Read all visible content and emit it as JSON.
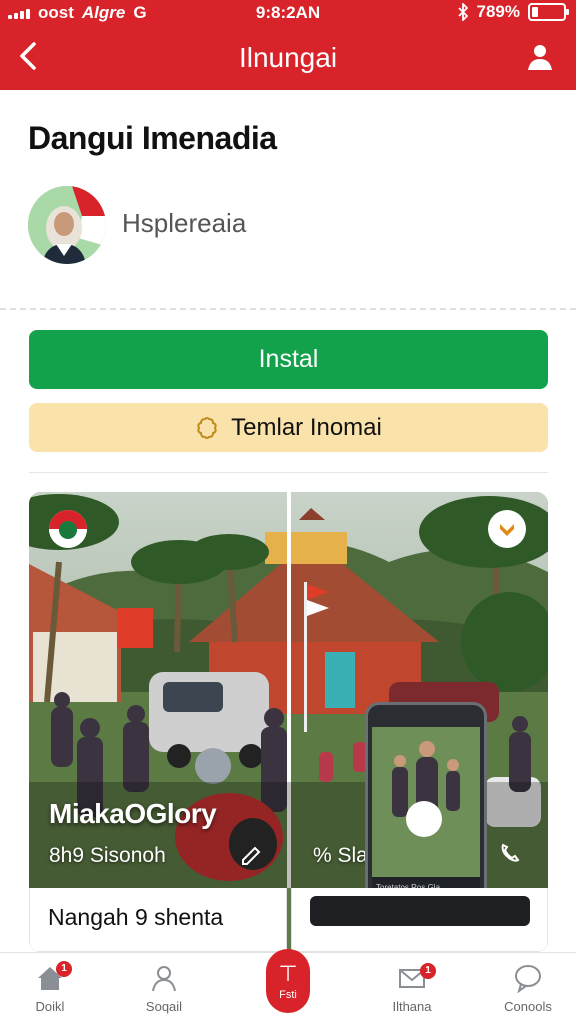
{
  "status_bar": {
    "carrier": "oost",
    "network": "Algre",
    "network_glyph": "G",
    "time": "9:8:2AN",
    "battery_percent": "789%",
    "battery_level": 0.2
  },
  "header": {
    "title": "Ilnungai",
    "back_icon": "back-arrow-icon",
    "user_icon": "user-profile-icon",
    "color": "#d8232a"
  },
  "app": {
    "name": "Dangui Imenadia",
    "publisher": "Hsplereaia"
  },
  "actions": {
    "install_label": "Instal",
    "secondary_label": "Temlar Inomai",
    "install_color": "#14a14b",
    "secondary_color": "#f9e3aa"
  },
  "media": {
    "left_caption_title": "MiakaOGlory",
    "left_caption_sub": "8h9 Sisonoh",
    "right_caption_sub": "% Slau",
    "phone_text": "Toretatos Ros Gla"
  },
  "items": [
    {
      "label": "Nangah  9  shenta"
    },
    {
      "label": ""
    }
  ],
  "bottom_nav": {
    "tabs": [
      {
        "label": "Doikl",
        "icon": "home-icon",
        "badge": "1"
      },
      {
        "label": "Soqail",
        "icon": "person-icon",
        "badge": ""
      },
      {
        "label": "Fsti",
        "icon": "center-action-icon",
        "badge": ""
      },
      {
        "label": "Ilthana",
        "icon": "mail-icon",
        "badge": "1"
      },
      {
        "label": "Conools",
        "icon": "chat-icon",
        "badge": ""
      }
    ],
    "active_color": "#d8232a"
  }
}
